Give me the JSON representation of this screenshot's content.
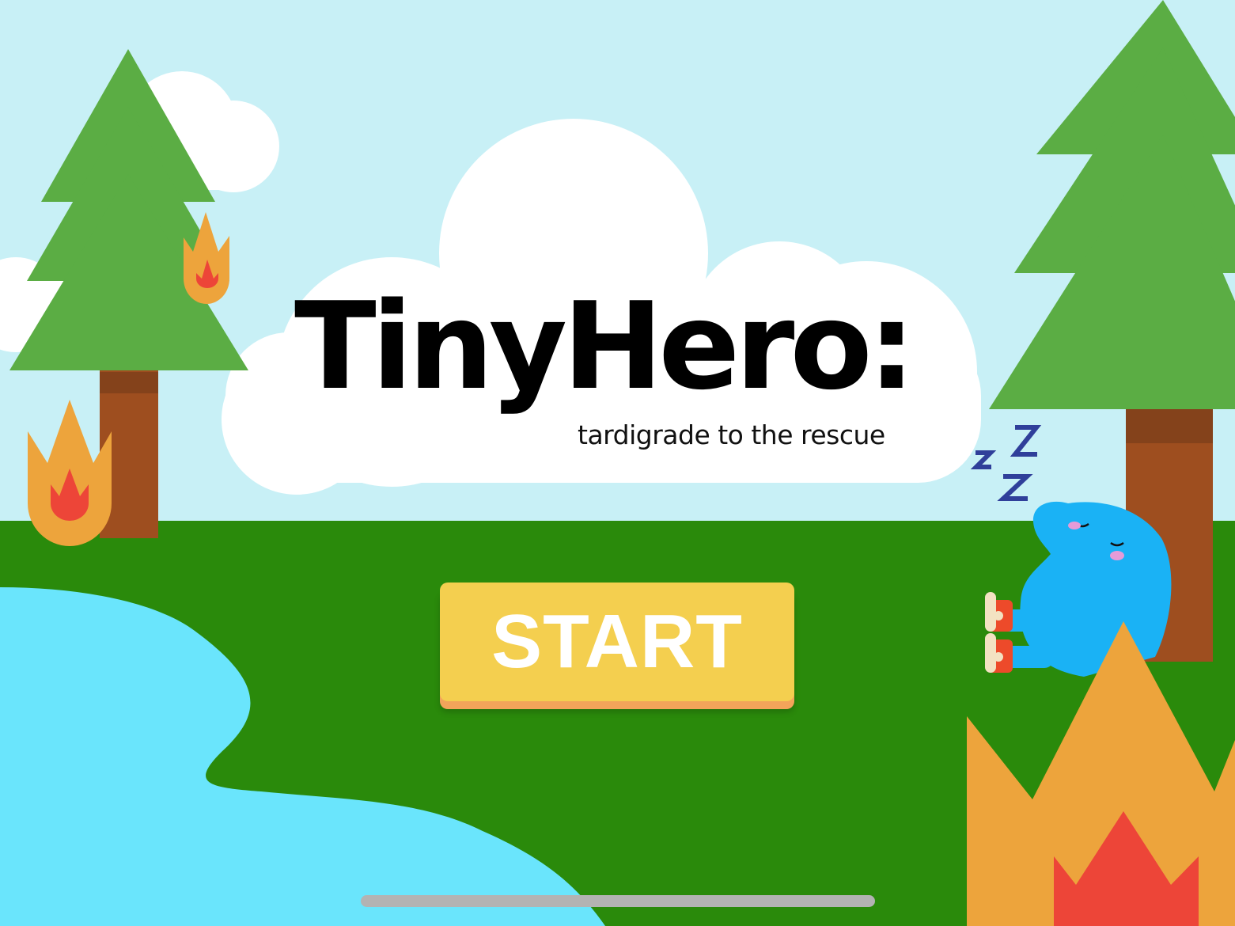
{
  "game": {
    "title": "TinyHero:",
    "subtitle": "tardigrade to the rescue",
    "start_label": "START"
  },
  "character": {
    "name": "tardigrade-character",
    "state": "sleeping",
    "sleep_text": "zZZ"
  },
  "colors": {
    "sky": "#c8f0f6",
    "grass": "#2a8a0b",
    "water": "#6ae5fc",
    "tree_leaves": "#5bad44",
    "tree_trunk": "#9e4e1f",
    "fire_outer": "#eda43c",
    "fire_inner": "#ed4538",
    "start_button": "#f4cf4f",
    "tardigrade": "#1ab2f5"
  }
}
